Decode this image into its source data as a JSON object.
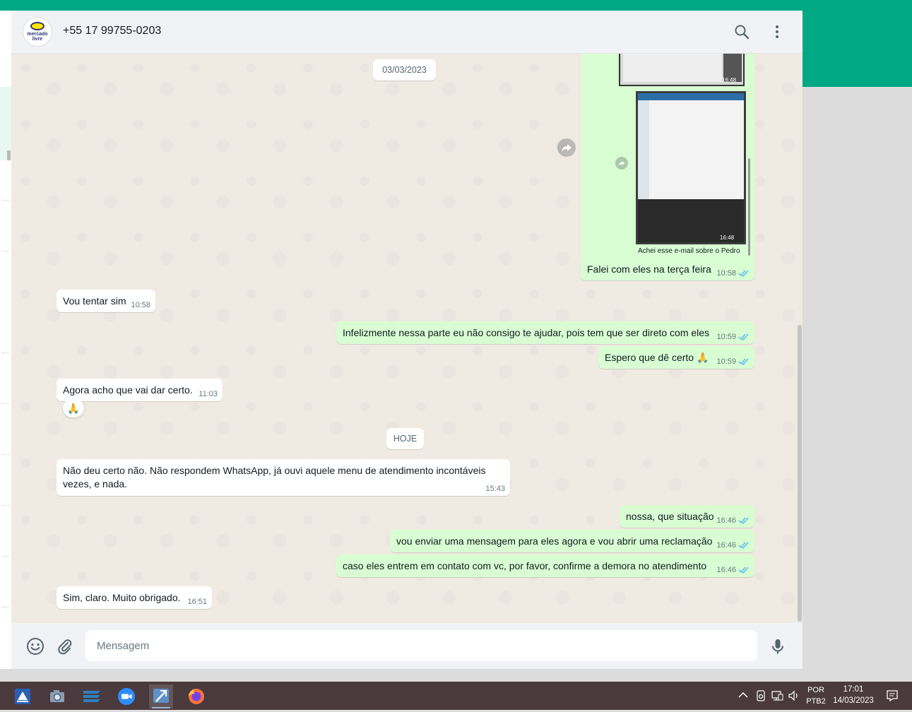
{
  "header": {
    "avatar_text": "mercado livre",
    "contact": "+55 17 99755-0203"
  },
  "media": {
    "time1": "16:48",
    "time2": "16:48",
    "caption": "Achei esse e-mail sobre o Pedro"
  },
  "dates": {
    "first": "03/03/2023",
    "today": "HOJE"
  },
  "messages": [
    {
      "dir": "out",
      "text": "Falei com eles na terça feira",
      "time": "10:58"
    },
    {
      "dir": "in",
      "text": "Vou tentar sim",
      "time": "10:58"
    },
    {
      "dir": "out",
      "text": "Infelizmente nessa parte eu não consigo te ajudar, pois tem que ser direto com eles",
      "time": "10:59"
    },
    {
      "dir": "out",
      "text": "Espero que dê certo 🙏",
      "time": "10:59"
    },
    {
      "dir": "in",
      "text": "Agora acho que vai dar certo.",
      "time": "11:03",
      "reaction": "🙏"
    },
    {
      "dir": "in",
      "text": "Não deu certo não.  Não respondem WhatsApp, já ouvi aquele menu de atendimento incontáveis vezes, e nada.",
      "time": "15:43"
    },
    {
      "dir": "out",
      "text": "nossa, que situação",
      "time": "16:46"
    },
    {
      "dir": "out",
      "text": "vou enviar uma mensagem para eles agora e vou abrir uma reclamação",
      "time": "16:46"
    },
    {
      "dir": "out",
      "text": "caso eles entrem em contato com vc, por favor, confirme a demora no atendimento",
      "time": "16:46"
    },
    {
      "dir": "in",
      "text": "Sim, claro. Muito obrigado.",
      "time": "16:51"
    }
  ],
  "composer": {
    "placeholder": "Mensagem"
  },
  "taskbar": {
    "lang_top": "POR",
    "lang_bottom": "PTB2",
    "clock_time": "17:01",
    "clock_date": "14/03/2023"
  },
  "colors": {
    "accent": "#00a884",
    "outgoing_bubble": "#d9fdd3",
    "incoming_bubble": "#ffffff",
    "read_ticks": "#53bdeb",
    "chat_bg": "#efeae2"
  },
  "icons": {
    "search": "search-icon",
    "menu": "kebab-menu-icon",
    "emoji": "emoji-icon",
    "attach": "paperclip-icon",
    "mic": "microphone-icon",
    "forward": "forward-icon"
  }
}
